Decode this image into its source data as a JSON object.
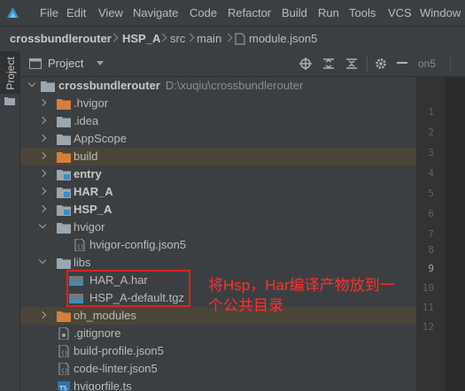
{
  "menu": [
    "File",
    "Edit",
    "View",
    "Navigate",
    "Code",
    "Refactor",
    "Build",
    "Run",
    "Tools",
    "VCS",
    "Window"
  ],
  "breadcrumb": [
    "crossbundlerouter",
    "HSP_A",
    "src",
    "main",
    "module.json5"
  ],
  "side_stripe_label": "Project",
  "panel": {
    "title": "Project"
  },
  "tree": [
    {
      "label": "crossbundlerouter",
      "path": "D:\\xuqiu\\crossbundlerouter",
      "icon": "folder-icon",
      "expanded": true,
      "bold": true
    },
    {
      "label": ".hvigor",
      "icon": "folder-orange-icon"
    },
    {
      "label": ".idea",
      "icon": "folder-icon"
    },
    {
      "label": "AppScope",
      "icon": "folder-icon"
    },
    {
      "label": "build",
      "icon": "folder-orange-icon"
    },
    {
      "label": "entry",
      "icon": "module-folder-icon",
      "bold": true
    },
    {
      "label": "HAR_A",
      "icon": "module-folder-icon",
      "bold": true
    },
    {
      "label": "HSP_A",
      "icon": "module-folder-icon",
      "bold": true
    },
    {
      "label": "hvigor",
      "icon": "folder-icon",
      "expanded": true
    },
    {
      "label": "hvigor-config.json5",
      "icon": "json-file-icon"
    },
    {
      "label": "libs",
      "icon": "folder-icon",
      "expanded": true
    },
    {
      "label": "HAR_A.har",
      "icon": "archive-file-icon"
    },
    {
      "label": "HSP_A-default.tgz",
      "icon": "archive-file-icon"
    },
    {
      "label": "oh_modules",
      "icon": "folder-orange-icon"
    },
    {
      "label": ".gitignore",
      "icon": "file-icon"
    },
    {
      "label": "build-profile.json5",
      "icon": "json-file-icon"
    },
    {
      "label": "code-linter.json5",
      "icon": "json-file-icon"
    },
    {
      "label": "hvigorfile.ts",
      "icon": "ts-file-icon"
    }
  ],
  "editor": {
    "tab_label": "on5",
    "line_numbers": [
      "1",
      "2",
      "3",
      "4",
      "5",
      "6",
      "7",
      "8",
      "9",
      "10",
      "11",
      "12"
    ],
    "current_line": "9"
  },
  "annotation": {
    "line1": "将Hsp，Har编译产物放到一",
    "line2": "个公共目录"
  },
  "colors": {
    "accent": "#3592c4",
    "selection": "#4a4538",
    "annotation": "#ff3030"
  }
}
